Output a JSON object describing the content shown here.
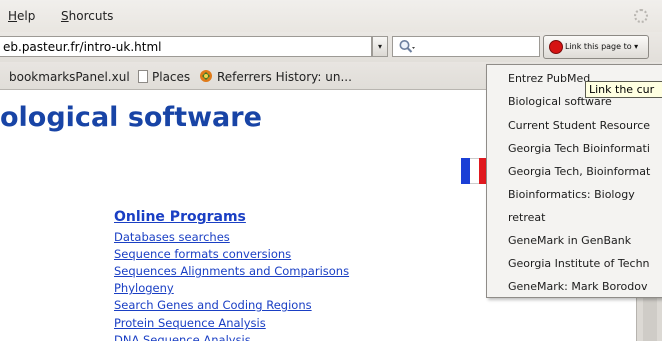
{
  "menubar": {
    "items": [
      {
        "label": "Help",
        "accel": "H",
        "rest": "elp"
      },
      {
        "label": "Shorcuts",
        "accel": "S",
        "rest": "horcuts"
      }
    ]
  },
  "navbar": {
    "url": "eb.pasteur.fr/intro-uk.html",
    "url_dropmarker": "▾",
    "link_button_label": "Link this page to ▾"
  },
  "bookmarks": {
    "items": [
      {
        "label": "bookmarksPanel.xul"
      },
      {
        "label": "Places"
      },
      {
        "label": "Referrers History: un..."
      }
    ]
  },
  "page": {
    "title": "ological software",
    "section_heading": "Online Programs",
    "links": [
      "Databases searches",
      "Sequence formats conversions",
      "Sequences Alignments and Comparisons",
      "Phylogeny",
      "Search Genes and Coding Regions",
      "Protein Sequence Analysis",
      "DNA Sequence Analysis"
    ],
    "flag_colors": {
      "blue": "#1b3fd6",
      "white": "#ffffff",
      "red": "#e0191f"
    }
  },
  "dropdown": {
    "items": [
      "Entrez PubMed",
      "Biological software",
      "Current Student Resource",
      "Georgia Tech Bioinformati",
      "Georgia Tech, Bioinformat",
      "Bioinformatics: Biology",
      "retreat",
      "GeneMark in GenBank",
      "Georgia Institute of Techn",
      "GeneMark: Mark Borodov"
    ]
  },
  "tooltip": {
    "text": "Link the cur"
  },
  "colors": {
    "link": "#1a3fc4",
    "title": "#1844a6",
    "tooltip_bg": "#ffffe1"
  }
}
